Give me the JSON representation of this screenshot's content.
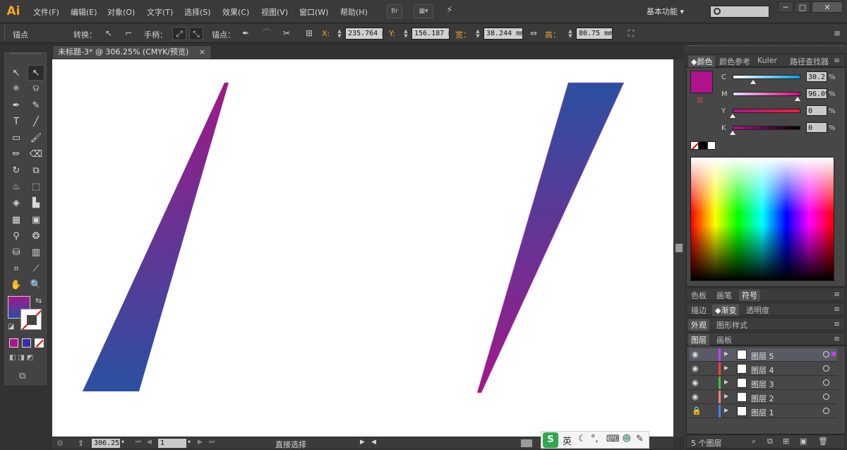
{
  "app": {
    "logo": "Ai"
  },
  "menu": [
    "文件(F)",
    "编辑(E)",
    "对象(O)",
    "文字(T)",
    "选择(S)",
    "效果(C)",
    "视图(V)",
    "窗口(W)",
    "帮助(H)"
  ],
  "menubar_icons": {
    "bridge": "Br"
  },
  "workspace": {
    "label": "基本功能"
  },
  "window_buttons": [
    "─",
    "□",
    "✕"
  ],
  "control": {
    "selection_type": "锚点",
    "convert_label": "转换：",
    "handles_label": "手柄：",
    "anchor_label": "锚点：",
    "x_label": "X:",
    "x_value": "235.764 m",
    "y_label": "Y:",
    "y_value": "156.187 m",
    "w_label": "宽：",
    "w_value": "38.244 mm",
    "h_label": "高：",
    "h_value": "80.75 mm"
  },
  "document": {
    "tab_title": "未标题-3* @ 306.25% (CMYK/预览)",
    "close": "×"
  },
  "status": {
    "zoom": "306.25",
    "artboard": "1",
    "tool": "直接选择"
  },
  "ime": {
    "lang": "英"
  },
  "color_panel": {
    "tabs": [
      "颜色",
      "颜色参考",
      "Kuler",
      "路径查找器"
    ],
    "fill_color": "#b0138c",
    "channels": [
      {
        "label": "C",
        "value": "30.2",
        "color_from": "#ffffff",
        "color_to": "#00a0e9",
        "pos": 0.302
      },
      {
        "label": "M",
        "value": "96.09",
        "color_from": "#e0e0ff",
        "color_to": "#e4007f",
        "pos": 0.9609
      },
      {
        "label": "Y",
        "value": "0",
        "color_from": "#b0138c",
        "color_to": "#ff1a3c",
        "pos": 0
      },
      {
        "label": "K",
        "value": "0",
        "color_from": "#b0138c",
        "color_to": "#000000",
        "pos": 0
      }
    ],
    "pct": "%"
  },
  "swatch_tabs": [
    "色板",
    "画笔",
    "符号"
  ],
  "stroke_tabs": [
    "描边",
    "渐变",
    "透明度"
  ],
  "appearance_tabs": [
    "外观",
    "图形样式"
  ],
  "layers_tabs": [
    "图层",
    "画板"
  ],
  "layers": [
    {
      "name": "图层 5",
      "color": "#c040ff",
      "selected": true
    },
    {
      "name": "图层 4",
      "color": "#ff4040",
      "selected": false
    },
    {
      "name": "图层 3",
      "color": "#40c040",
      "selected": false
    },
    {
      "name": "图层 2",
      "color": "#ff8080",
      "selected": false
    },
    {
      "name": "图层 1",
      "color": "#4080ff",
      "selected": false
    }
  ],
  "layers_footer": {
    "count": "5 个图层"
  },
  "artwork": {
    "shape1": {
      "gradient_top": "#a01888",
      "gradient_bottom": "#2a50a0"
    },
    "shape2": {
      "gradient_top": "#2a50a0",
      "gradient_bottom": "#a01888"
    }
  },
  "tool_colors": {
    "fill": "#8a2fa8",
    "stroke": "none"
  }
}
